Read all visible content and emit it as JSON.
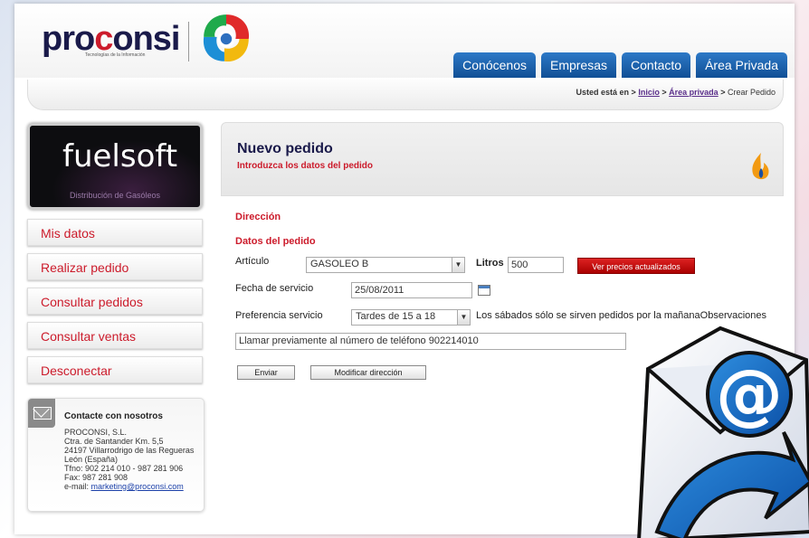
{
  "header": {
    "logo_text_a": "pro",
    "logo_text_c": "c",
    "logo_text_b": "onsi",
    "logo_subtitle": "Tecnologías de la Información",
    "tabs": [
      "Conócenos",
      "Empresas",
      "Contacto",
      "Área Privada"
    ]
  },
  "breadcrumb": {
    "prefix": "Usted está en",
    "links": [
      "Inicio",
      "Área privada"
    ],
    "sep": ">",
    "current": "Crear Pedido"
  },
  "sidebar": {
    "brand": "fuelsoft",
    "brand_sub": "Distribución de Gasóleos",
    "menu": [
      "Mis datos",
      "Realizar pedido",
      "Consultar pedidos",
      "Consultar ventas",
      "Desconectar"
    ],
    "contact": {
      "title": "Contacte con nosotros",
      "lines": [
        "PROCONSI, S.L.",
        "Ctra. de Santander Km. 5,5",
        "24197 Villarrodrigo de las Regueras",
        "León (España)",
        "Tfno: 902 214 010 - 987 281 906",
        "Fax: 987 281 908"
      ],
      "email_label": "e-mail:",
      "email": "marketing@proconsi.com"
    }
  },
  "main": {
    "title": "Nuevo pedido",
    "subtitle": "Introduzca los datos del pedido",
    "section_direccion": "Dirección",
    "section_datos": "Datos del pedido",
    "articulo_label": "Artículo",
    "articulo_value": "GASOLEO B",
    "litros_label": "Litros",
    "litros_value": "500",
    "precios_button": "Ver precios actualizados",
    "fecha_label": "Fecha de servicio",
    "fecha_value": "25/08/2011",
    "preferencia_label": "Preferencia servicio",
    "preferencia_value": "Tardes de 15 a 18",
    "sabados_note": "Los sábados sólo se sirven pedidos por la mañana",
    "observaciones_label": "Observaciones",
    "observaciones_value": "Llamar previamente al número de teléfono 902214010",
    "enviar_button": "Enviar",
    "modificar_button": "Modificar dirección"
  },
  "colors": {
    "brand_blue": "#104f95",
    "brand_red": "#cc1b2b",
    "title_navy": "#1a1a4a"
  }
}
